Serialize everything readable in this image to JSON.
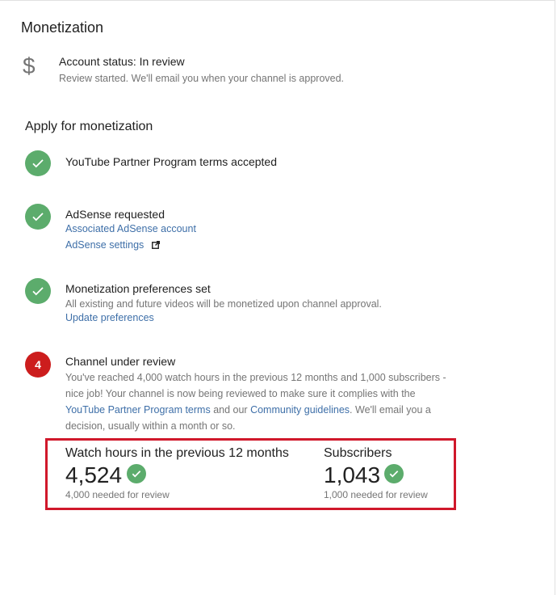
{
  "page": {
    "title": "Monetization"
  },
  "account": {
    "icon": "dollar-icon",
    "status": "Account status: In review",
    "description": "Review started. We'll email you when your channel is approved."
  },
  "apply": {
    "title": "Apply for monetization",
    "steps": [
      {
        "state": "done",
        "icon": "check-icon",
        "title": "YouTube Partner Program terms accepted"
      },
      {
        "state": "done",
        "icon": "check-icon",
        "title": "AdSense requested",
        "links": [
          "Associated AdSense account",
          "AdSense settings"
        ]
      },
      {
        "state": "done",
        "icon": "check-icon",
        "title": "Monetization preferences set",
        "description": "All existing and future videos will be monetized upon channel approval.",
        "links": [
          "Update preferences"
        ]
      },
      {
        "state": "current",
        "number": "4",
        "title": "Channel under review",
        "text_part1": "You've reached 4,000 watch hours in the previous 12 months and 1,000 subscribers - nice job! Your channel is now being reviewed to make sure it complies with the ",
        "link1": "YouTube Partner Program terms",
        "text_part2": " and our ",
        "link2": "Community guidelines",
        "text_part3": ". We'll email you a decision, usually within a month or so."
      }
    ]
  },
  "stats": {
    "highlight_color": "#d0182b",
    "watch_hours": {
      "label": "Watch hours in the previous 12 months",
      "value": "4,524",
      "needed": "4,000 needed for review"
    },
    "subscribers": {
      "label": "Subscribers",
      "value": "1,043",
      "needed": "1,000 needed for review"
    }
  },
  "colors": {
    "success": "#5cac6c",
    "alert": "#cc1d1d",
    "link": "#3e6fa8"
  }
}
